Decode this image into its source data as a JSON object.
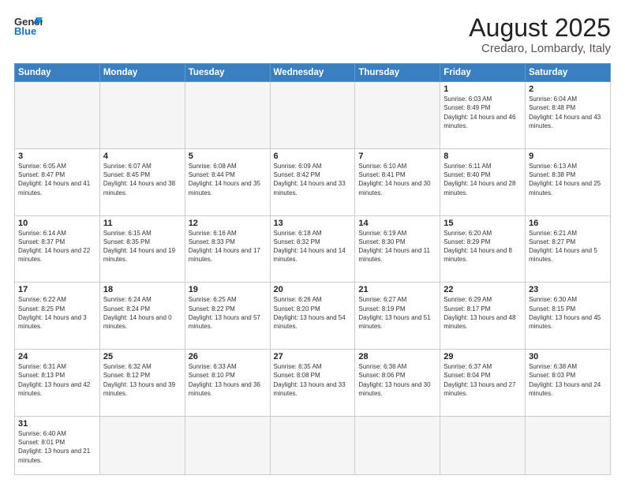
{
  "header": {
    "logo_general": "General",
    "logo_blue": "Blue",
    "title": "August 2025",
    "subtitle": "Credaro, Lombardy, Italy"
  },
  "weekdays": [
    "Sunday",
    "Monday",
    "Tuesday",
    "Wednesday",
    "Thursday",
    "Friday",
    "Saturday"
  ],
  "weeks": [
    [
      {
        "day": "",
        "info": ""
      },
      {
        "day": "",
        "info": ""
      },
      {
        "day": "",
        "info": ""
      },
      {
        "day": "",
        "info": ""
      },
      {
        "day": "",
        "info": ""
      },
      {
        "day": "1",
        "info": "Sunrise: 6:03 AM\nSunset: 8:49 PM\nDaylight: 14 hours and 46 minutes."
      },
      {
        "day": "2",
        "info": "Sunrise: 6:04 AM\nSunset: 8:48 PM\nDaylight: 14 hours and 43 minutes."
      }
    ],
    [
      {
        "day": "3",
        "info": "Sunrise: 6:05 AM\nSunset: 8:47 PM\nDaylight: 14 hours and 41 minutes."
      },
      {
        "day": "4",
        "info": "Sunrise: 6:07 AM\nSunset: 8:45 PM\nDaylight: 14 hours and 38 minutes."
      },
      {
        "day": "5",
        "info": "Sunrise: 6:08 AM\nSunset: 8:44 PM\nDaylight: 14 hours and 35 minutes."
      },
      {
        "day": "6",
        "info": "Sunrise: 6:09 AM\nSunset: 8:42 PM\nDaylight: 14 hours and 33 minutes."
      },
      {
        "day": "7",
        "info": "Sunrise: 6:10 AM\nSunset: 8:41 PM\nDaylight: 14 hours and 30 minutes."
      },
      {
        "day": "8",
        "info": "Sunrise: 6:11 AM\nSunset: 8:40 PM\nDaylight: 14 hours and 28 minutes."
      },
      {
        "day": "9",
        "info": "Sunrise: 6:13 AM\nSunset: 8:38 PM\nDaylight: 14 hours and 25 minutes."
      }
    ],
    [
      {
        "day": "10",
        "info": "Sunrise: 6:14 AM\nSunset: 8:37 PM\nDaylight: 14 hours and 22 minutes."
      },
      {
        "day": "11",
        "info": "Sunrise: 6:15 AM\nSunset: 8:35 PM\nDaylight: 14 hours and 19 minutes."
      },
      {
        "day": "12",
        "info": "Sunrise: 6:16 AM\nSunset: 8:33 PM\nDaylight: 14 hours and 17 minutes."
      },
      {
        "day": "13",
        "info": "Sunrise: 6:18 AM\nSunset: 8:32 PM\nDaylight: 14 hours and 14 minutes."
      },
      {
        "day": "14",
        "info": "Sunrise: 6:19 AM\nSunset: 8:30 PM\nDaylight: 14 hours and 11 minutes."
      },
      {
        "day": "15",
        "info": "Sunrise: 6:20 AM\nSunset: 8:29 PM\nDaylight: 14 hours and 8 minutes."
      },
      {
        "day": "16",
        "info": "Sunrise: 6:21 AM\nSunset: 8:27 PM\nDaylight: 14 hours and 5 minutes."
      }
    ],
    [
      {
        "day": "17",
        "info": "Sunrise: 6:22 AM\nSunset: 8:25 PM\nDaylight: 14 hours and 3 minutes."
      },
      {
        "day": "18",
        "info": "Sunrise: 6:24 AM\nSunset: 8:24 PM\nDaylight: 14 hours and 0 minutes."
      },
      {
        "day": "19",
        "info": "Sunrise: 6:25 AM\nSunset: 8:22 PM\nDaylight: 13 hours and 57 minutes."
      },
      {
        "day": "20",
        "info": "Sunrise: 6:26 AM\nSunset: 8:20 PM\nDaylight: 13 hours and 54 minutes."
      },
      {
        "day": "21",
        "info": "Sunrise: 6:27 AM\nSunset: 8:19 PM\nDaylight: 13 hours and 51 minutes."
      },
      {
        "day": "22",
        "info": "Sunrise: 6:29 AM\nSunset: 8:17 PM\nDaylight: 13 hours and 48 minutes."
      },
      {
        "day": "23",
        "info": "Sunrise: 6:30 AM\nSunset: 8:15 PM\nDaylight: 13 hours and 45 minutes."
      }
    ],
    [
      {
        "day": "24",
        "info": "Sunrise: 6:31 AM\nSunset: 8:13 PM\nDaylight: 13 hours and 42 minutes."
      },
      {
        "day": "25",
        "info": "Sunrise: 6:32 AM\nSunset: 8:12 PM\nDaylight: 13 hours and 39 minutes."
      },
      {
        "day": "26",
        "info": "Sunrise: 6:33 AM\nSunset: 8:10 PM\nDaylight: 13 hours and 36 minutes."
      },
      {
        "day": "27",
        "info": "Sunrise: 6:35 AM\nSunset: 8:08 PM\nDaylight: 13 hours and 33 minutes."
      },
      {
        "day": "28",
        "info": "Sunrise: 6:36 AM\nSunset: 8:06 PM\nDaylight: 13 hours and 30 minutes."
      },
      {
        "day": "29",
        "info": "Sunrise: 6:37 AM\nSunset: 8:04 PM\nDaylight: 13 hours and 27 minutes."
      },
      {
        "day": "30",
        "info": "Sunrise: 6:38 AM\nSunset: 8:03 PM\nDaylight: 13 hours and 24 minutes."
      }
    ],
    [
      {
        "day": "31",
        "info": "Sunrise: 6:40 AM\nSunset: 8:01 PM\nDaylight: 13 hours and 21 minutes."
      },
      {
        "day": "",
        "info": ""
      },
      {
        "day": "",
        "info": ""
      },
      {
        "day": "",
        "info": ""
      },
      {
        "day": "",
        "info": ""
      },
      {
        "day": "",
        "info": ""
      },
      {
        "day": "",
        "info": ""
      }
    ]
  ]
}
